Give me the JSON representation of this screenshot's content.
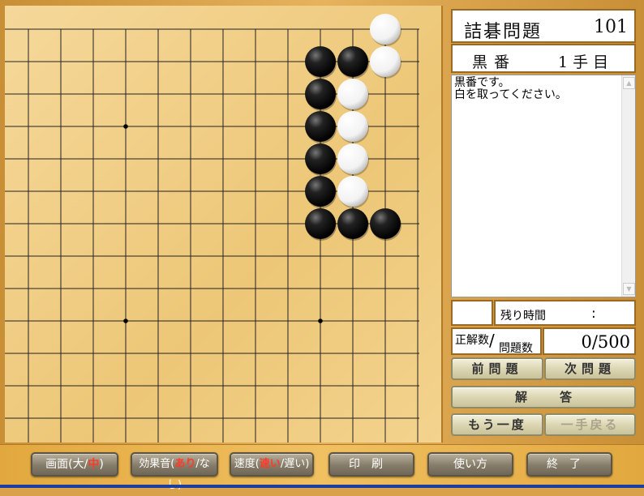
{
  "problem": {
    "title": "詰碁問題",
    "number": "101"
  },
  "turn": {
    "player": "黒番",
    "move": "1手目"
  },
  "message": {
    "lines": [
      "黒番です。",
      "白を取ってください。"
    ]
  },
  "timer": {
    "label": "残り時間",
    "value": ":"
  },
  "score": {
    "correct_label": "正解数",
    "slash": "/",
    "total_label": "問題数",
    "value": "0/500"
  },
  "panel_buttons": {
    "prev": "前問題",
    "next": "次問題",
    "answer": "解答",
    "retry": "もう一度",
    "undo": "一手戻る"
  },
  "bottom_buttons": {
    "screen": {
      "pre": "画面(大/",
      "acc": "中",
      "post": ")"
    },
    "sound": {
      "pre": "効果音(",
      "acc": "あり",
      "post": "/なし)"
    },
    "speed": {
      "pre": "速度(",
      "acc": "速い",
      "post": "/遅い)"
    },
    "print": "印刷",
    "howto": "使い方",
    "quit": "終了"
  },
  "board": {
    "black_stones": [
      [
        9,
        1
      ],
      [
        10,
        1
      ],
      [
        9,
        2
      ],
      [
        9,
        3
      ],
      [
        9,
        4
      ],
      [
        9,
        5
      ],
      [
        9,
        6
      ],
      [
        10,
        6
      ],
      [
        11,
        6
      ]
    ],
    "white_stones": [
      [
        11,
        0
      ],
      [
        11,
        1
      ],
      [
        10,
        2
      ],
      [
        10,
        3
      ],
      [
        10,
        4
      ],
      [
        10,
        5
      ]
    ],
    "hoshi": [
      [
        3,
        3
      ],
      [
        3,
        9
      ],
      [
        9,
        9
      ]
    ]
  },
  "colors": {
    "black": "#111111",
    "white": "#ffffff",
    "line": "#222222",
    "board": "#f0cc80",
    "accent": "#ff3a2a"
  }
}
